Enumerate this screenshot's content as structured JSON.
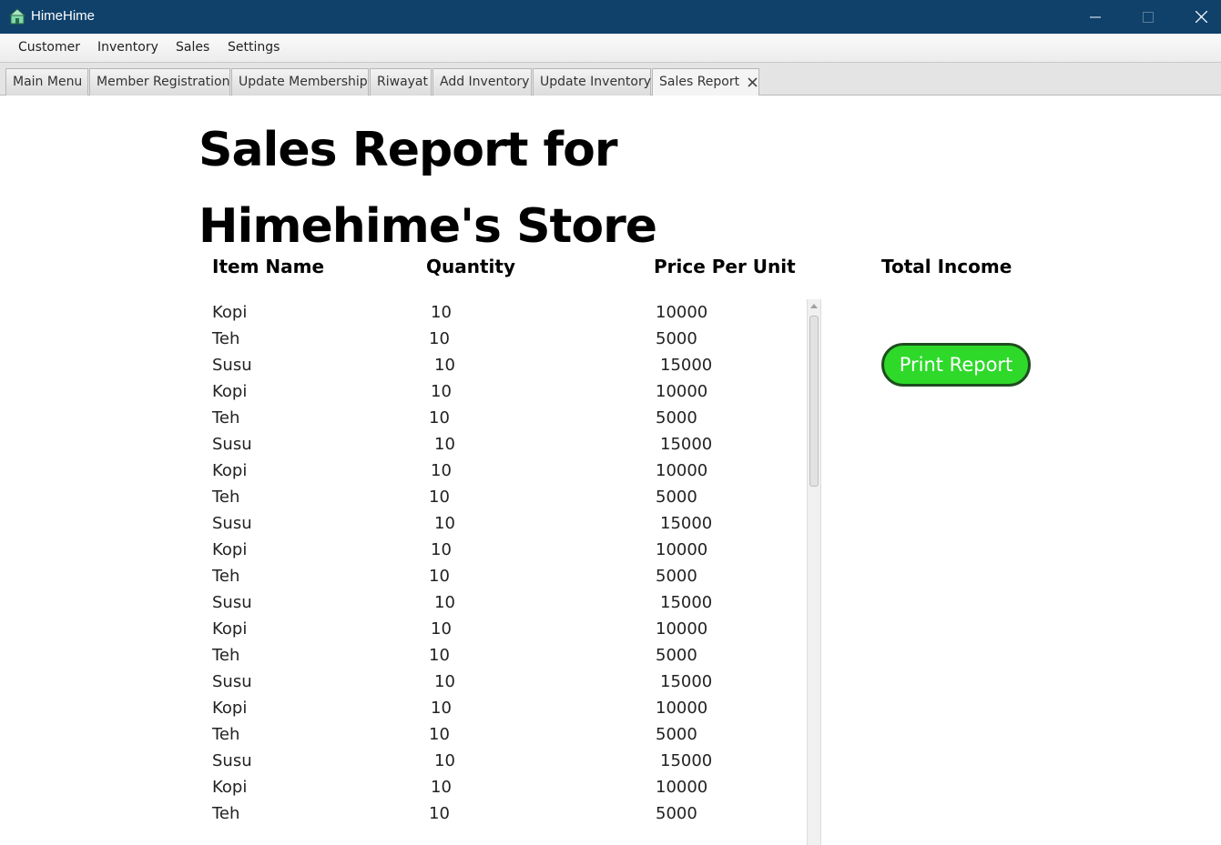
{
  "window": {
    "title": "HimeHime",
    "icon": "store-icon"
  },
  "menu": [
    "Customer",
    "Inventory",
    "Sales",
    "Settings"
  ],
  "tabs": [
    {
      "label": "Main Menu"
    },
    {
      "label": "Member Registration"
    },
    {
      "label": "Update Membership"
    },
    {
      "label": "Riwayat"
    },
    {
      "label": "Add Inventory"
    },
    {
      "label": "Update Inventory"
    },
    {
      "label": "Sales Report",
      "active": true,
      "closable": true
    }
  ],
  "report": {
    "title_line1": "Sales Report for",
    "title_line2": "Himehime's Store",
    "columns": {
      "item_name": "Item Name",
      "quantity": "Quantity",
      "price_per_unit": "Price Per Unit",
      "total_income": "Total Income"
    },
    "rows": [
      {
        "item": "Kopi",
        "qty": "10",
        "price": "10000"
      },
      {
        "item": "Teh",
        "qty": "10",
        "price": "5000"
      },
      {
        "item": "Susu",
        "qty": "10",
        "price": "15000"
      },
      {
        "item": "Kopi",
        "qty": "10",
        "price": "10000"
      },
      {
        "item": "Teh",
        "qty": "10",
        "price": "5000"
      },
      {
        "item": "Susu",
        "qty": "10",
        "price": "15000"
      },
      {
        "item": "Kopi",
        "qty": "10",
        "price": "10000"
      },
      {
        "item": "Teh",
        "qty": "10",
        "price": "5000"
      },
      {
        "item": "Susu",
        "qty": "10",
        "price": "15000"
      },
      {
        "item": "Kopi",
        "qty": "10",
        "price": "10000"
      },
      {
        "item": "Teh",
        "qty": "10",
        "price": "5000"
      },
      {
        "item": "Susu",
        "qty": "10",
        "price": "15000"
      },
      {
        "item": "Kopi",
        "qty": "10",
        "price": "10000"
      },
      {
        "item": "Teh",
        "qty": "10",
        "price": "5000"
      },
      {
        "item": "Susu",
        "qty": "10",
        "price": "15000"
      },
      {
        "item": "Kopi",
        "qty": "10",
        "price": "10000"
      },
      {
        "item": "Teh",
        "qty": "10",
        "price": "5000"
      },
      {
        "item": "Susu",
        "qty": "10",
        "price": "15000"
      },
      {
        "item": "Kopi",
        "qty": "10",
        "price": "10000"
      },
      {
        "item": "Teh",
        "qty": "10",
        "price": "5000"
      }
    ],
    "print_button": "Print Report"
  },
  "colors": {
    "titlebar": "#0f416b",
    "print_button": "#2ed92a"
  }
}
